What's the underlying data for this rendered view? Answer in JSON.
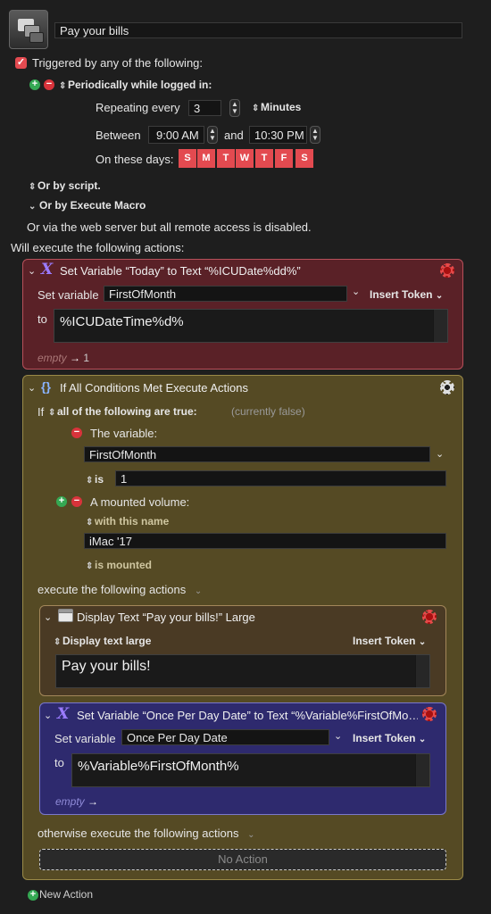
{
  "macro": {
    "name": "Pay your bills",
    "trigger_header": "Triggered by any of the following:",
    "periodic": {
      "title": "Periodically while logged in:",
      "repeat_label": "Repeating every",
      "repeat_value": "3",
      "unit": "Minutes",
      "between_label": "Between",
      "start": "9:00 AM",
      "and_label": "and",
      "end": "10:30 PM",
      "days_label": "On these days:",
      "days": [
        "S",
        "M",
        "T",
        "W",
        "T",
        "F",
        "S"
      ]
    },
    "or_script": "Or by script.",
    "or_execute": "Or by Execute Macro",
    "web_note": "Or via the web server but all remote access is disabled.",
    "actions_header": "Will execute the following actions:"
  },
  "action1": {
    "title": "Set Variable “Today” to Text “%ICUDate%dd%”",
    "set_label": "Set variable",
    "var": "FirstOfMonth",
    "insert_token": "Insert Token",
    "to_label": "to",
    "value": "%ICUDateTime%d%",
    "footer_empty": "empty",
    "footer_num": "1"
  },
  "action2": {
    "title": "If All Conditions Met Execute Actions",
    "if_label": "If",
    "condition_mode": "all of the following are true:",
    "state": "(currently false)",
    "cond1_label": "The variable:",
    "cond1_var": "FirstOfMonth",
    "cond1_op": "is",
    "cond1_value": "1",
    "cond2_label": "A mounted volume:",
    "cond2_mode": "with this name",
    "cond2_value": "iMac '17",
    "cond2_state": "is mounted",
    "execute_label": "execute the following actions",
    "otherwise_label": "otherwise execute the following actions",
    "no_action": "No Action"
  },
  "display": {
    "title": "Display Text “Pay your bills!” Large",
    "mode": "Display text large",
    "insert_token": "Insert Token",
    "text": "Pay your bills!"
  },
  "setvar2": {
    "title": "Set Variable “Once Per Day Date” to Text “%Variable%FirstOfMo…",
    "set_label": "Set variable",
    "var": "Once Per Day Date",
    "insert_token": "Insert Token",
    "to_label": "to",
    "value": "%Variable%FirstOfMonth%",
    "footer_empty": "empty"
  },
  "new_action": "New Action",
  "colors": {
    "action1_bg": "#5a2127",
    "action2_bg": "#554a24",
    "display_bg": "#4a3a24",
    "setvar2_bg": "#2e2a6e",
    "day_red": "#e34a50"
  }
}
